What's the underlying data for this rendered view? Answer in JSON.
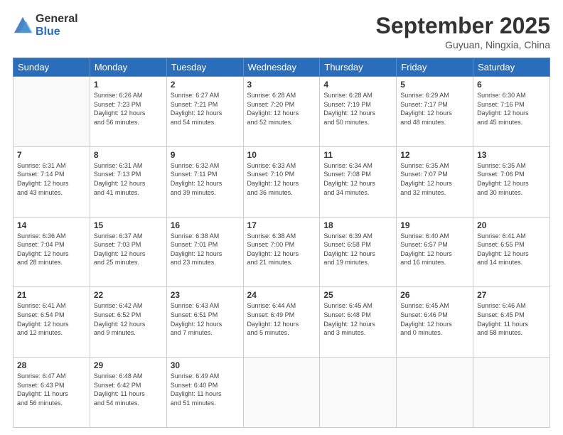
{
  "header": {
    "logo_line1": "General",
    "logo_line2": "Blue",
    "month": "September 2025",
    "location": "Guyuan, Ningxia, China"
  },
  "weekdays": [
    "Sunday",
    "Monday",
    "Tuesday",
    "Wednesday",
    "Thursday",
    "Friday",
    "Saturday"
  ],
  "weeks": [
    [
      {
        "num": "",
        "info": ""
      },
      {
        "num": "1",
        "info": "Sunrise: 6:26 AM\nSunset: 7:23 PM\nDaylight: 12 hours\nand 56 minutes."
      },
      {
        "num": "2",
        "info": "Sunrise: 6:27 AM\nSunset: 7:21 PM\nDaylight: 12 hours\nand 54 minutes."
      },
      {
        "num": "3",
        "info": "Sunrise: 6:28 AM\nSunset: 7:20 PM\nDaylight: 12 hours\nand 52 minutes."
      },
      {
        "num": "4",
        "info": "Sunrise: 6:28 AM\nSunset: 7:19 PM\nDaylight: 12 hours\nand 50 minutes."
      },
      {
        "num": "5",
        "info": "Sunrise: 6:29 AM\nSunset: 7:17 PM\nDaylight: 12 hours\nand 48 minutes."
      },
      {
        "num": "6",
        "info": "Sunrise: 6:30 AM\nSunset: 7:16 PM\nDaylight: 12 hours\nand 45 minutes."
      }
    ],
    [
      {
        "num": "7",
        "info": "Sunrise: 6:31 AM\nSunset: 7:14 PM\nDaylight: 12 hours\nand 43 minutes."
      },
      {
        "num": "8",
        "info": "Sunrise: 6:31 AM\nSunset: 7:13 PM\nDaylight: 12 hours\nand 41 minutes."
      },
      {
        "num": "9",
        "info": "Sunrise: 6:32 AM\nSunset: 7:11 PM\nDaylight: 12 hours\nand 39 minutes."
      },
      {
        "num": "10",
        "info": "Sunrise: 6:33 AM\nSunset: 7:10 PM\nDaylight: 12 hours\nand 36 minutes."
      },
      {
        "num": "11",
        "info": "Sunrise: 6:34 AM\nSunset: 7:08 PM\nDaylight: 12 hours\nand 34 minutes."
      },
      {
        "num": "12",
        "info": "Sunrise: 6:35 AM\nSunset: 7:07 PM\nDaylight: 12 hours\nand 32 minutes."
      },
      {
        "num": "13",
        "info": "Sunrise: 6:35 AM\nSunset: 7:06 PM\nDaylight: 12 hours\nand 30 minutes."
      }
    ],
    [
      {
        "num": "14",
        "info": "Sunrise: 6:36 AM\nSunset: 7:04 PM\nDaylight: 12 hours\nand 28 minutes."
      },
      {
        "num": "15",
        "info": "Sunrise: 6:37 AM\nSunset: 7:03 PM\nDaylight: 12 hours\nand 25 minutes."
      },
      {
        "num": "16",
        "info": "Sunrise: 6:38 AM\nSunset: 7:01 PM\nDaylight: 12 hours\nand 23 minutes."
      },
      {
        "num": "17",
        "info": "Sunrise: 6:38 AM\nSunset: 7:00 PM\nDaylight: 12 hours\nand 21 minutes."
      },
      {
        "num": "18",
        "info": "Sunrise: 6:39 AM\nSunset: 6:58 PM\nDaylight: 12 hours\nand 19 minutes."
      },
      {
        "num": "19",
        "info": "Sunrise: 6:40 AM\nSunset: 6:57 PM\nDaylight: 12 hours\nand 16 minutes."
      },
      {
        "num": "20",
        "info": "Sunrise: 6:41 AM\nSunset: 6:55 PM\nDaylight: 12 hours\nand 14 minutes."
      }
    ],
    [
      {
        "num": "21",
        "info": "Sunrise: 6:41 AM\nSunset: 6:54 PM\nDaylight: 12 hours\nand 12 minutes."
      },
      {
        "num": "22",
        "info": "Sunrise: 6:42 AM\nSunset: 6:52 PM\nDaylight: 12 hours\nand 9 minutes."
      },
      {
        "num": "23",
        "info": "Sunrise: 6:43 AM\nSunset: 6:51 PM\nDaylight: 12 hours\nand 7 minutes."
      },
      {
        "num": "24",
        "info": "Sunrise: 6:44 AM\nSunset: 6:49 PM\nDaylight: 12 hours\nand 5 minutes."
      },
      {
        "num": "25",
        "info": "Sunrise: 6:45 AM\nSunset: 6:48 PM\nDaylight: 12 hours\nand 3 minutes."
      },
      {
        "num": "26",
        "info": "Sunrise: 6:45 AM\nSunset: 6:46 PM\nDaylight: 12 hours\nand 0 minutes."
      },
      {
        "num": "27",
        "info": "Sunrise: 6:46 AM\nSunset: 6:45 PM\nDaylight: 11 hours\nand 58 minutes."
      }
    ],
    [
      {
        "num": "28",
        "info": "Sunrise: 6:47 AM\nSunset: 6:43 PM\nDaylight: 11 hours\nand 56 minutes."
      },
      {
        "num": "29",
        "info": "Sunrise: 6:48 AM\nSunset: 6:42 PM\nDaylight: 11 hours\nand 54 minutes."
      },
      {
        "num": "30",
        "info": "Sunrise: 6:49 AM\nSunset: 6:40 PM\nDaylight: 11 hours\nand 51 minutes."
      },
      {
        "num": "",
        "info": ""
      },
      {
        "num": "",
        "info": ""
      },
      {
        "num": "",
        "info": ""
      },
      {
        "num": "",
        "info": ""
      }
    ]
  ]
}
